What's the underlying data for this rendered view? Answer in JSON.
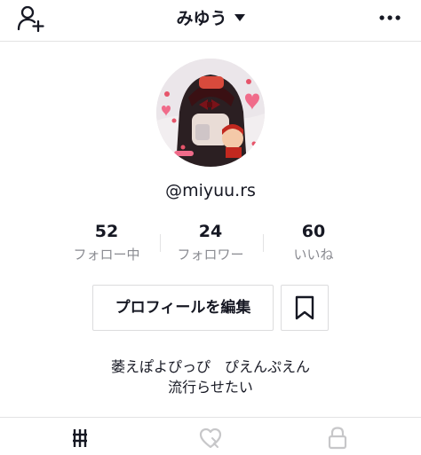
{
  "header": {
    "title": "みゆう",
    "left_icon": "add-user-icon",
    "right_icon": "more-options-icon"
  },
  "profile": {
    "username": "@miyuu.rs",
    "avatar_icon": "avatar-image"
  },
  "stats": [
    {
      "value": "52",
      "label": "フォロー中"
    },
    {
      "value": "24",
      "label": "フォロワー"
    },
    {
      "value": "60",
      "label": "いいね"
    }
  ],
  "actions": {
    "edit_profile": "プロフィールを編集",
    "bookmark_icon": "bookmark-icon"
  },
  "bio": [
    "萎えぽよぴっぴ　ぴえんぷえん",
    "流行らせたい"
  ],
  "tabs": [
    {
      "icon": "grid-icon",
      "active": true
    },
    {
      "icon": "liked-heart-icon",
      "active": false
    },
    {
      "icon": "lock-icon",
      "active": false
    }
  ],
  "colors": {
    "text": "#161823",
    "secondary": "#8a8b91",
    "border": "#e3e3e4",
    "inactive_icon": "#c7c7c9"
  }
}
